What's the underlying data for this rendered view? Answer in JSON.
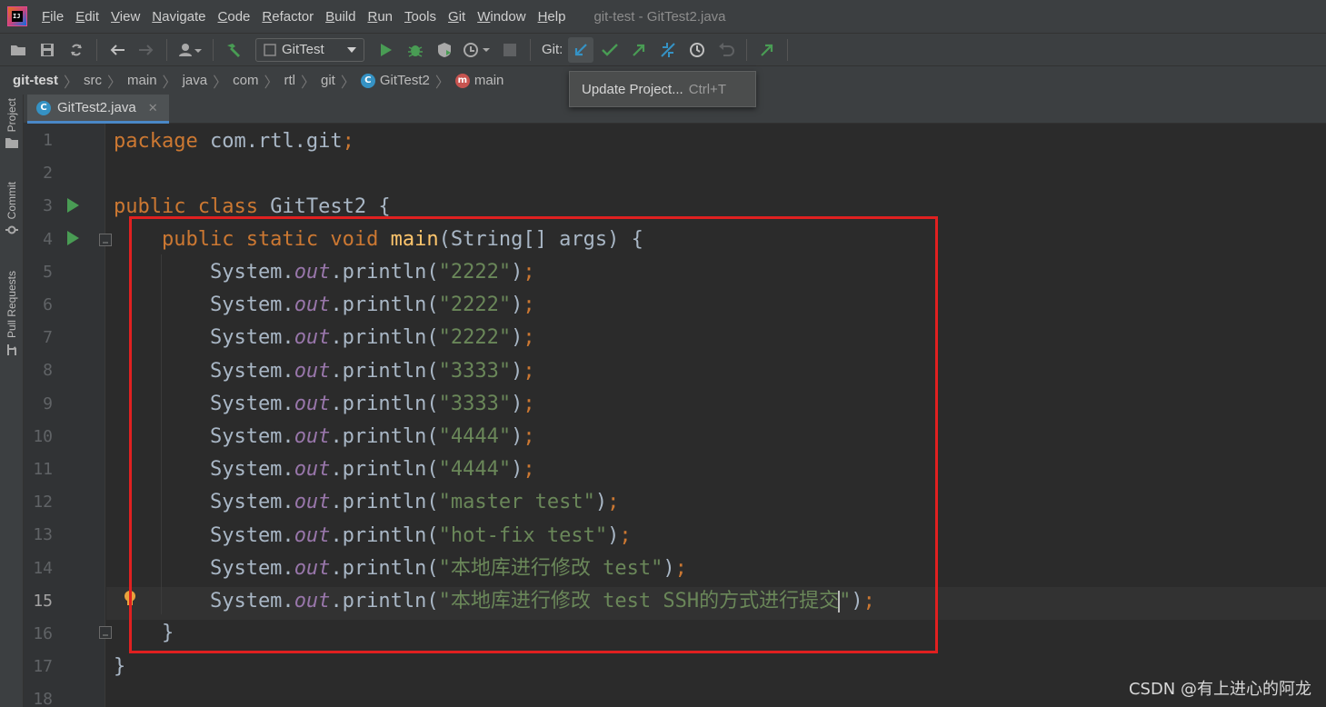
{
  "menubar": {
    "items": [
      {
        "label": "File",
        "mnemonic": "F",
        "rest": "ile"
      },
      {
        "label": "Edit",
        "mnemonic": "E",
        "rest": "dit"
      },
      {
        "label": "View",
        "mnemonic": "V",
        "rest": "iew"
      },
      {
        "label": "Navigate",
        "mnemonic": "N",
        "rest": "avigate"
      },
      {
        "label": "Code",
        "mnemonic": "C",
        "rest": "ode"
      },
      {
        "label": "Refactor",
        "mnemonic": "R",
        "rest": "efactor"
      },
      {
        "label": "Build",
        "mnemonic": "B",
        "rest": "uild"
      },
      {
        "label": "Run",
        "mnemonic": "R",
        "rest": "un",
        "tail_underlined": "u"
      },
      {
        "label": "Tools",
        "mnemonic": "T",
        "rest": "ools"
      },
      {
        "label": "Git",
        "mnemonic": "G",
        "rest": "it"
      },
      {
        "label": "Window",
        "mnemonic": "W",
        "rest": "indow"
      },
      {
        "label": "Help",
        "mnemonic": "H",
        "rest": "elp"
      }
    ],
    "window_title": "git-test - GitTest2.java"
  },
  "toolbar": {
    "run_config": "GitTest",
    "git_label": "Git:"
  },
  "breadcrumb": {
    "project": "git-test",
    "path": [
      "src",
      "main",
      "java",
      "com",
      "rtl",
      "git"
    ],
    "class_name": "GitTest2",
    "method_name": "main"
  },
  "tooltip": {
    "label": "Update Project...",
    "shortcut": "Ctrl+T"
  },
  "sidebar": {
    "tabs": [
      "Project",
      "Commit",
      "Pull Requests"
    ]
  },
  "editor": {
    "tab_label": "GitTest2.java",
    "current_line": 15,
    "line_numbers": [
      "1",
      "2",
      "3",
      "4",
      "5",
      "6",
      "7",
      "8",
      "9",
      "10",
      "11",
      "12",
      "13",
      "14",
      "15",
      "16",
      "17",
      "18"
    ],
    "package_name": "com.rtl.git",
    "class_name": "GitTest2",
    "method_name": "main",
    "param_type": "String[]",
    "param_name": "args",
    "println_args": [
      "\"2222\"",
      "\"2222\"",
      "\"2222\"",
      "\"3333\"",
      "\"3333\"",
      "\"4444\"",
      "\"4444\"",
      "\"master test\"",
      "\"hot-fix test\"",
      "\"本地库进行修改 test\"",
      "\"本地库进行修改 test SSH的方式进行提交\""
    ]
  },
  "watermark": "CSDN @有上进心的阿龙",
  "colors": {
    "keyword": "#cc7832",
    "string": "#6a8759",
    "field": "#9876aa",
    "method": "#ffc66d",
    "highlight_box": "#e02020"
  }
}
